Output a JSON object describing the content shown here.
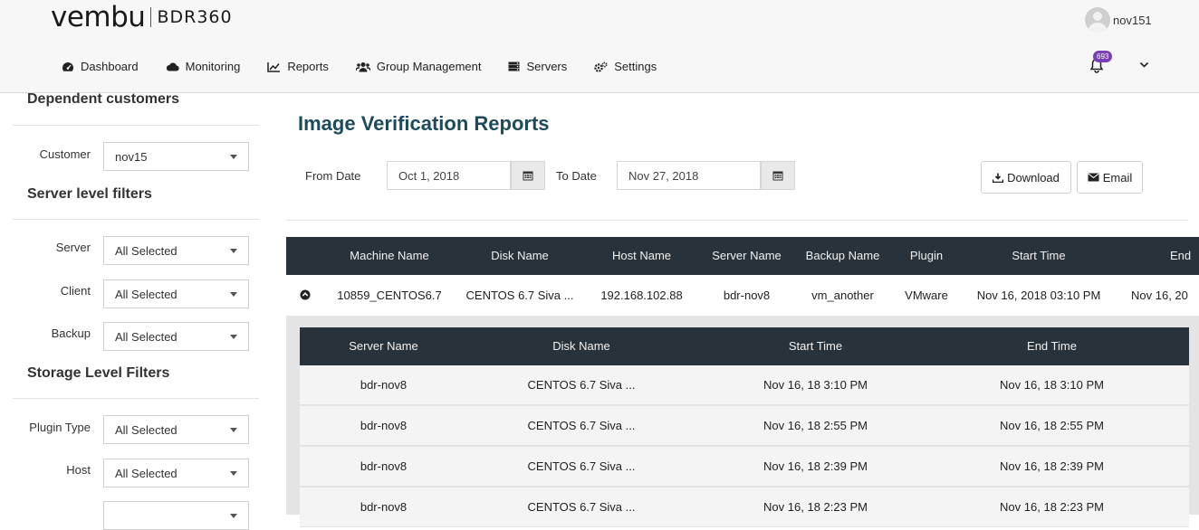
{
  "header": {
    "brand": "vembu",
    "product": "BDR360",
    "user": "nov151",
    "notification_count": "693"
  },
  "nav": [
    {
      "label": "Dashboard",
      "icon": "dashboard-icon"
    },
    {
      "label": "Monitoring",
      "icon": "cloud-icon"
    },
    {
      "label": "Reports",
      "icon": "line-chart-icon"
    },
    {
      "label": "Group Management",
      "icon": "users-icon"
    },
    {
      "label": "Servers",
      "icon": "server-icon"
    },
    {
      "label": "Settings",
      "icon": "gears-icon"
    }
  ],
  "sidebar": {
    "dependent_heading": "Dependent customers",
    "customer_label": "Customer",
    "customer_value": "nov15",
    "server_heading": "Server level filters",
    "server_label": "Server",
    "server_value": "All Selected",
    "client_label": "Client",
    "client_value": "All Selected",
    "backup_label": "Backup",
    "backup_value": "All Selected",
    "storage_heading": "Storage Level Filters",
    "plugin_label": "Plugin Type",
    "plugin_value": "All Selected",
    "host_label": "Host",
    "host_value": "All Selected"
  },
  "main": {
    "title": "Image Verification Reports",
    "from_label": "From Date",
    "from_value": "Oct 1, 2018",
    "to_label": "To Date",
    "to_value": "Nov 27, 2018",
    "download_label": "Download",
    "email_label": "Email"
  },
  "table": {
    "columns": [
      "Machine Name",
      "Disk Name",
      "Host Name",
      "Server Name",
      "Backup Name",
      "Plugin",
      "Start Time",
      "End"
    ],
    "row": [
      "10859_CENTOS6.7",
      "CENTOS 6.7 Siva ...",
      "192.168.102.88",
      "bdr-nov8",
      "vm_another",
      "VMware",
      "Nov 16, 2018 03:10 PM",
      "Nov 16, 20"
    ]
  },
  "subtable": {
    "columns": [
      "Server Name",
      "Disk Name",
      "Start Time",
      "End Time"
    ],
    "rows": [
      [
        "bdr-nov8",
        "CENTOS 6.7 Siva ...",
        "Nov 16, 18 3:10 PM",
        "Nov 16, 18 3:10 PM"
      ],
      [
        "bdr-nov8",
        "CENTOS 6.7 Siva ...",
        "Nov 16, 18 2:55 PM",
        "Nov 16, 18 2:55 PM"
      ],
      [
        "bdr-nov8",
        "CENTOS 6.7 Siva ...",
        "Nov 16, 18 2:39 PM",
        "Nov 16, 18 2:39 PM"
      ],
      [
        "bdr-nov8",
        "CENTOS 6.7 Siva ...",
        "Nov 16, 18 2:23 PM",
        "Nov 16, 18 2:23 PM"
      ]
    ]
  }
}
